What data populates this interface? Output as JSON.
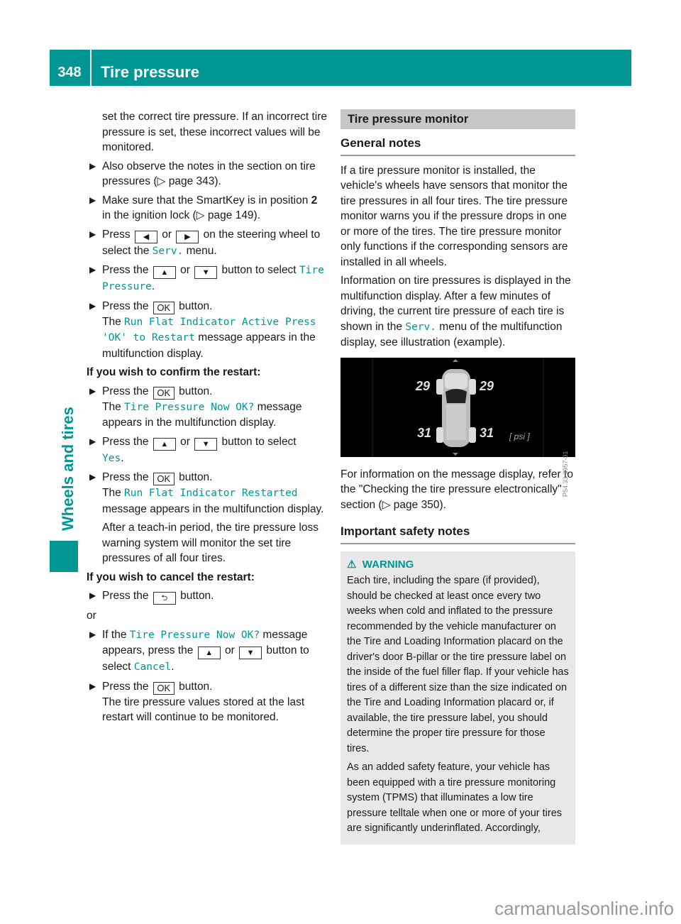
{
  "header": {
    "page_number": "348",
    "title": "Tire pressure"
  },
  "side_tab": {
    "label": "Wheels and tires"
  },
  "left": {
    "intro": "set the correct tire pressure. If an incorrect tire pressure is set, these incorrect values will be monitored.",
    "step1": "Also observe the notes in the section on tire pressures (▷ page 343).",
    "step2_pre": "Make sure that the SmartKey is in position ",
    "step2_bold": "2",
    "step2_post": " in the ignition lock (▷ page 149).",
    "step3_a": "Press ",
    "step3_b": " or ",
    "step3_c": " on the steering wheel to select the ",
    "step3_mono": "Serv.",
    "step3_d": " menu.",
    "step4_a": "Press the ",
    "step4_b": " or ",
    "step4_c": " button to select ",
    "step4_mono": "Tire Pressure",
    "step4_d": ".",
    "step5_a": "Press the ",
    "step5_b": " button.",
    "step5_c": "The ",
    "step5_mono": "Run Flat Indicator Active Press 'OK' to Restart",
    "step5_d": " message appears in the multifunction display.",
    "confirm_heading": "If you wish to confirm the restart:",
    "step6_a": "Press the ",
    "step6_b": " button.",
    "step6_c": "The ",
    "step6_mono": "Tire Pressure Now OK?",
    "step6_d": " message appears in the multifunction display.",
    "step7_a": "Press the ",
    "step7_b": " or ",
    "step7_c": " button to select ",
    "step7_mono": "Yes",
    "step7_d": ".",
    "step8_a": "Press the ",
    "step8_b": " button.",
    "step8_c": "The ",
    "step8_mono": "Run Flat Indicator Restarted",
    "step8_d": " message appears in the multifunction display.",
    "step8_note": "After a teach-in period, the tire pressure loss warning system will monitor the set tire pressures of all four tires.",
    "cancel_heading": "If you wish to cancel the restart:",
    "step9_a": "Press the ",
    "step9_b": " button.",
    "or_text": "or",
    "step10_a": "If the ",
    "step10_mono": "Tire Pressure Now OK?",
    "step10_b": " message appears, press the ",
    "step10_c": " or ",
    "step10_d": " button to select ",
    "step10_mono2": "Cancel",
    "step10_e": ".",
    "step11_a": "Press the ",
    "step11_b": " button.",
    "step11_c": "The tire pressure values stored at the last restart will continue to be monitored."
  },
  "keys": {
    "left": "◀",
    "right": "▶",
    "up": "▲",
    "down": "▼",
    "ok": "OK",
    "back": "⮌"
  },
  "arrow": "▶",
  "right": {
    "section_title": "Tire pressure monitor",
    "general_heading": "General notes",
    "para1": "If a tire pressure monitor is installed, the vehicle's wheels have sensors that monitor the tire pressures in all four tires. The tire pressure monitor warns you if the pressure drops in one or more of the tires. The tire pressure monitor only functions if the corresponding sensors are installed in all wheels.",
    "para2_a": "Information on tire pressures is displayed in the multifunction display. After a few minutes of driving, the current tire pressure of each tire is shown in the ",
    "para2_mono": "Serv.",
    "para2_b": " menu of the multifunction display, see illustration (example).",
    "illustration": {
      "front_left": "29",
      "front_right": "29",
      "rear_left": "31",
      "rear_right": "31",
      "unit": "[ psi ]",
      "code": "P54.33-3957-31"
    },
    "para3": "For information on the message display, refer to the \"Checking the tire pressure electronically\" section (▷ page 350).",
    "safety_heading": "Important safety notes",
    "warning": {
      "title": "WARNING",
      "para1": "Each tire, including the spare (if provided), should be checked at least once every two weeks when cold and inflated to the pressure recommended by the vehicle manufacturer on the Tire and Loading Information placard on the driver's door B-pillar or the tire pressure label on the inside of the fuel filler flap. If your vehicle has tires of a different size than the size indicated on the Tire and Loading Information placard or, if available, the tire pressure label, you should determine the proper tire pressure for those tires.",
      "para2": "As an added safety feature, your vehicle has been equipped with a tire pressure monitoring system (TPMS) that illuminates a low tire pressure telltale when one or more of your tires are significantly underinflated. Accordingly,"
    }
  },
  "watermark": "carmanualsonline.info",
  "colors": {
    "accent": "#009694",
    "section_bg": "#c7c7c7",
    "warning_bg": "#e8e8e8"
  }
}
